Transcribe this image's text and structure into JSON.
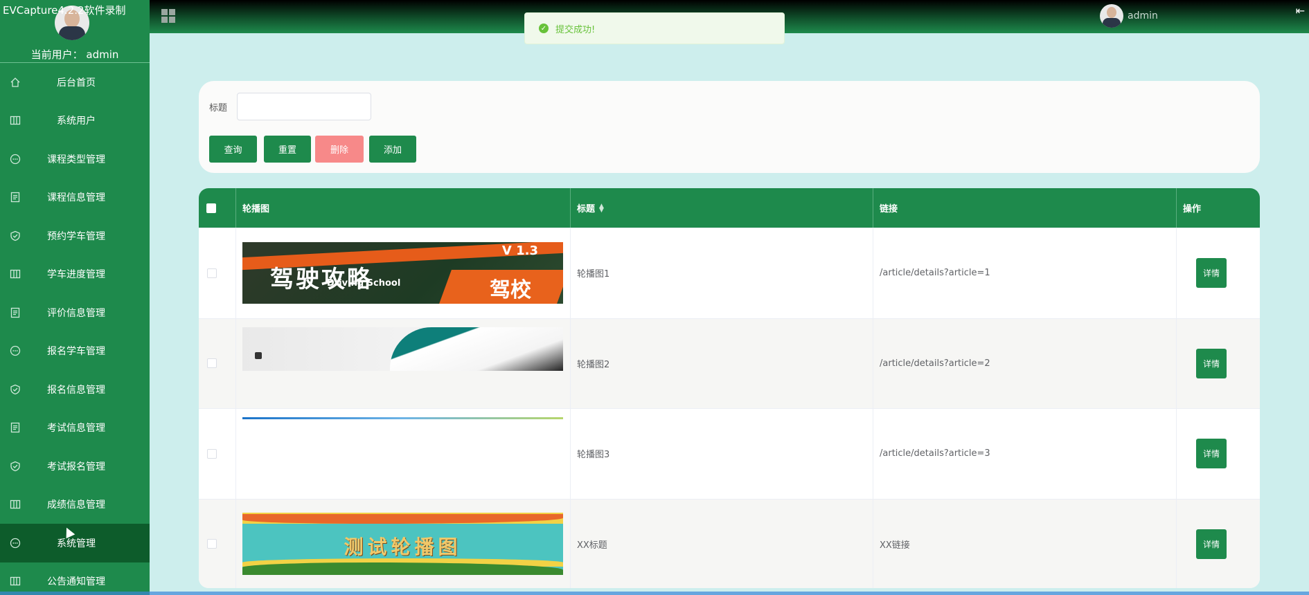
{
  "recording_banner": "EVCapture4.2.2软件录制",
  "sidebar": {
    "current_user_label": "当前用户： admin",
    "items": [
      {
        "label": "后台首页",
        "icon": "home-icon"
      },
      {
        "label": "系统用户",
        "icon": "columns-icon"
      },
      {
        "label": "课程类型管理",
        "icon": "chat-icon"
      },
      {
        "label": "课程信息管理",
        "icon": "document-icon"
      },
      {
        "label": "预约学车管理",
        "icon": "shield-check-icon"
      },
      {
        "label": "学车进度管理",
        "icon": "columns-icon"
      },
      {
        "label": "评价信息管理",
        "icon": "document-icon"
      },
      {
        "label": "报名学车管理",
        "icon": "chat-icon"
      },
      {
        "label": "报名信息管理",
        "icon": "shield-check-icon"
      },
      {
        "label": "考试信息管理",
        "icon": "document-icon"
      },
      {
        "label": "考试报名管理",
        "icon": "shield-check-icon"
      },
      {
        "label": "成绩信息管理",
        "icon": "columns-icon"
      },
      {
        "label": "系统管理",
        "icon": "chat-icon",
        "active": true
      },
      {
        "label": "公告通知管理",
        "icon": "columns-icon"
      }
    ]
  },
  "topbar": {
    "username": "admin"
  },
  "toast": {
    "message": "提交成功!"
  },
  "search": {
    "title_label": "标题",
    "title_value": "",
    "query_label": "查询",
    "reset_label": "重置",
    "delete_label": "删除",
    "add_label": "添加"
  },
  "table": {
    "headers": {
      "image": "轮播图",
      "title": "标题",
      "link": "链接",
      "action": "操作"
    },
    "rows": [
      {
        "title": "轮播图1",
        "link": "/article/details?article=1",
        "action": "详情",
        "image_text": {
          "t1": "驾驶攻略",
          "t2": "Driving School",
          "t3": "驾校",
          "ver": "V 1.3"
        }
      },
      {
        "title": "轮播图2",
        "link": "/article/details?article=2",
        "action": "详情"
      },
      {
        "title": "轮播图3",
        "link": "/article/details?article=3",
        "action": "详情"
      },
      {
        "title": "XX标题",
        "link": "XX链接",
        "action": "详情",
        "image_text": {
          "t1": "测试轮播图"
        }
      }
    ]
  },
  "colors": {
    "primary": "#1e8a4c",
    "sidebar_active": "#0d5c2b",
    "danger": "#f78989",
    "page_bg": "#cdeeed",
    "success": "#67c23a"
  }
}
